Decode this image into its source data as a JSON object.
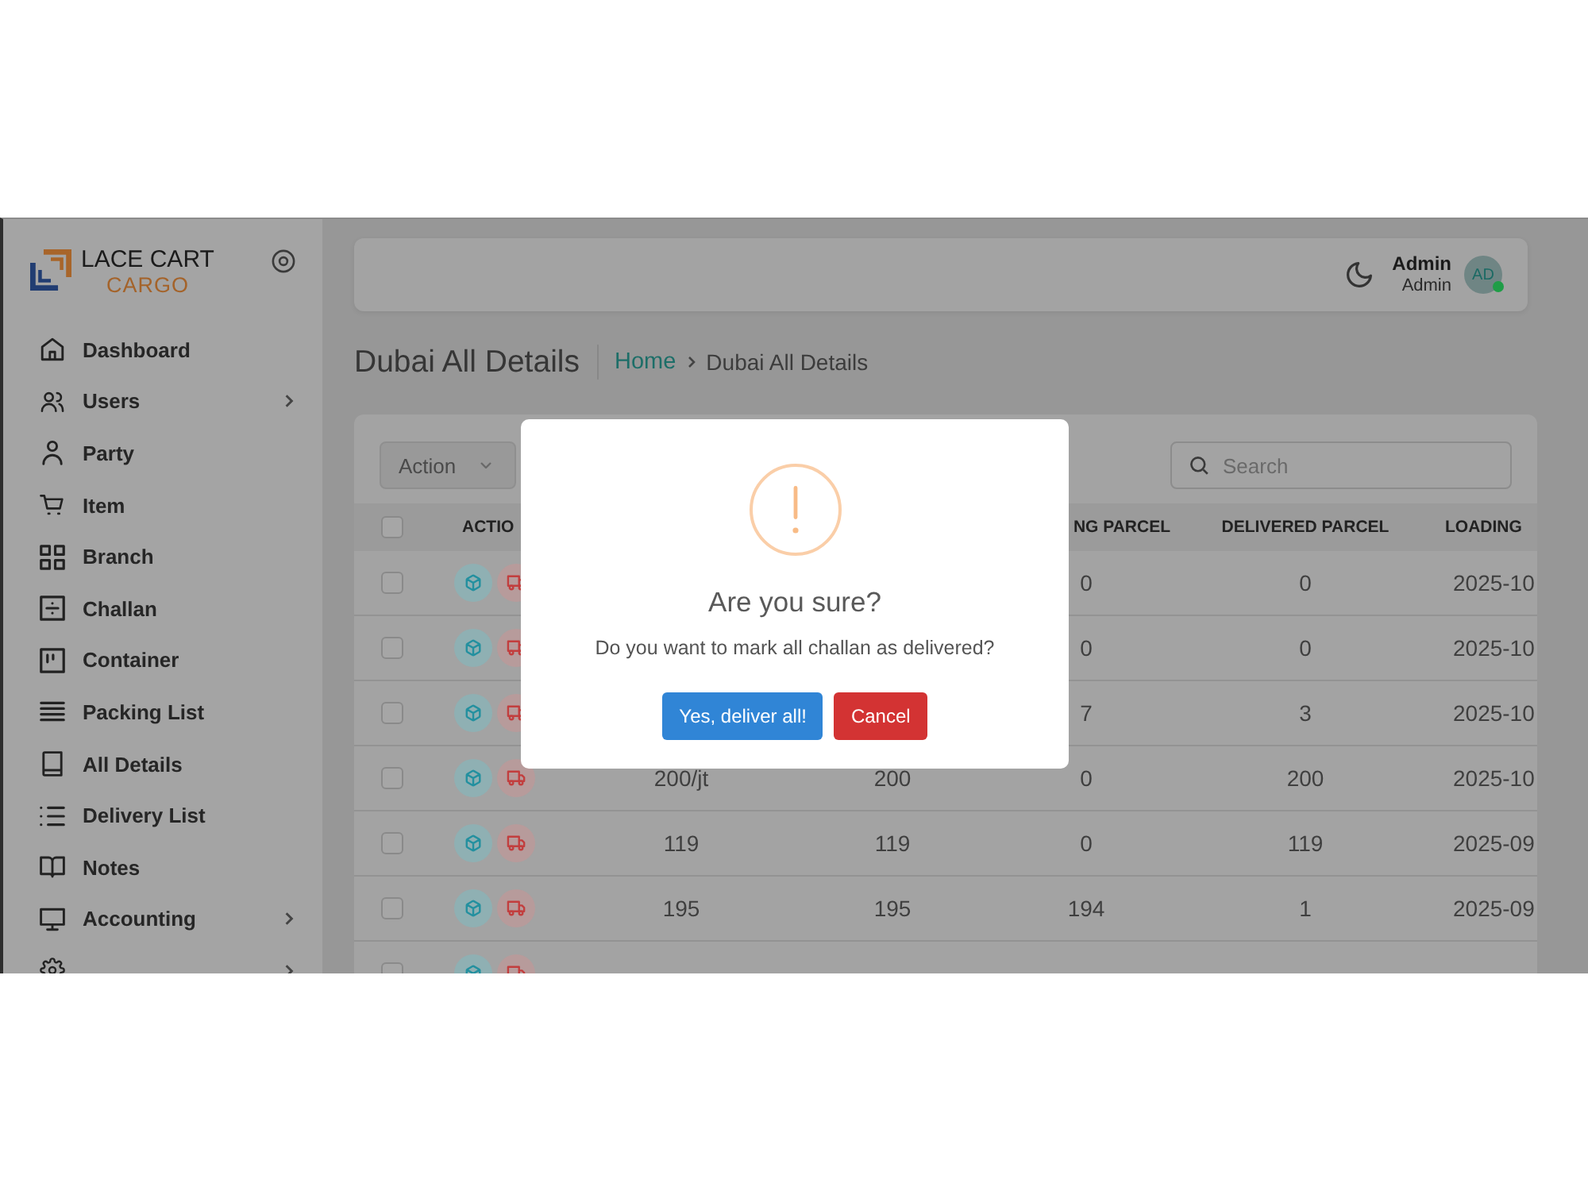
{
  "sidebar": {
    "logo": {
      "title": "LACE CART",
      "subtitle": "CARGO"
    },
    "items": [
      {
        "label": "Dashboard",
        "expandable": false,
        "selected": false
      },
      {
        "label": "Users",
        "expandable": true,
        "selected": false
      },
      {
        "label": "Party",
        "expandable": false,
        "selected": false
      },
      {
        "label": "Item",
        "expandable": false,
        "selected": false
      },
      {
        "label": "Branch",
        "expandable": false,
        "selected": false
      },
      {
        "label": "Challan",
        "expandable": false,
        "selected": false
      },
      {
        "label": "Container",
        "expandable": false,
        "selected": false
      },
      {
        "label": "Packing List",
        "expandable": false,
        "selected": false
      },
      {
        "label": "All Details",
        "expandable": false,
        "selected": false
      },
      {
        "label": "Delivery List",
        "expandable": false,
        "selected": false
      },
      {
        "label": "Notes",
        "expandable": false,
        "selected": false
      },
      {
        "label": "Accounting",
        "expandable": true,
        "selected": false
      },
      {
        "expandable": true,
        "selected": false
      }
    ]
  },
  "topbar": {
    "user": {
      "name": "Admin",
      "role": "Admin",
      "initials": "AD",
      "online": true
    }
  },
  "page": {
    "title": "Dubai All Details",
    "breadcrumb": [
      {
        "label": "Home",
        "kind": "link"
      },
      {
        "label": "Dubai All Details",
        "kind": "current"
      }
    ]
  },
  "toolbar": {
    "action_select": "Action",
    "search": {
      "placeholder": "Search"
    }
  },
  "table": {
    "header": {
      "checked": false,
      "column_2": "ACTIO",
      "column_5": "NG PARCEL",
      "column_6": "DELIVERED PARCEL",
      "column_7": "LOADING"
    },
    "rows": [
      {
        "checked": false,
        "column_5": "0",
        "column_6": "0",
        "column_7": "2025-10"
      },
      {
        "checked": false,
        "column_5": "0",
        "column_6": "0",
        "column_7": "2025-10"
      },
      {
        "checked": false,
        "column_5": "7",
        "column_6": "3",
        "column_7": "2025-10"
      },
      {
        "checked": false,
        "column_3": "200/jt",
        "column_4": "200",
        "column_5": "0",
        "column_6": "200",
        "column_7": "2025-10"
      },
      {
        "checked": false,
        "column_3": "119",
        "column_4": "119",
        "column_5": "0",
        "column_6": "119",
        "column_7": "2025-09"
      },
      {
        "checked": false,
        "column_3": "195",
        "column_4": "195",
        "column_5": "194",
        "column_6": "1",
        "column_7": "2025-09"
      },
      {
        "checked": false
      }
    ]
  },
  "dialog": {
    "title": "Are you sure?",
    "text": "Do you want to mark all challan as delivered?",
    "buttons": [
      {
        "label": "Yes, deliver all!",
        "kind": "confirm"
      },
      {
        "label": "Cancel",
        "kind": "cancel"
      }
    ]
  }
}
